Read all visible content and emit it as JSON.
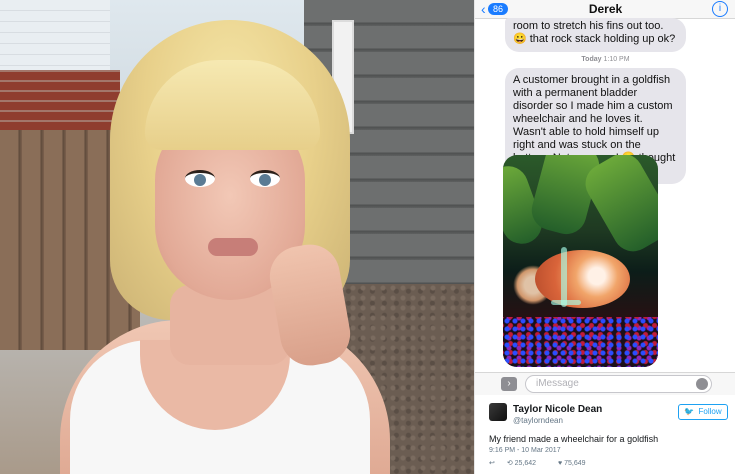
{
  "chat": {
    "back_badge": "86",
    "contact_name": "Derek",
    "msg1": "room to stretch his fins out too. 😀 that rock stack holding up ok?",
    "timestamp_day": "Today",
    "timestamp_time": "1:10 PM",
    "msg2": "A customer brought in a goldfish with a permanent bladder disorder so I made him a custom wheelchair and he loves it. Wasn't able to hold himself up right and was stuck on the bottom. Not anymore! 😀 thought u would get a kick out of it.",
    "input_placeholder": "iMessage"
  },
  "tweet": {
    "name": "Taylor Nicole Dean",
    "handle": "@taylorndean",
    "follow_label": "Follow",
    "text": "My friend made a wheelchair for a goldfish",
    "datetime": "9:16 PM - 10 Mar 2017",
    "retweets": "25,642",
    "likes": "75,649"
  },
  "icons": {
    "back": "chevron-left-icon",
    "info": "info-icon",
    "camera": "camera-icon",
    "mic": "mic-icon",
    "twitter_bird": "twitter-bird-icon",
    "reply": "reply-icon",
    "retweet": "retweet-icon",
    "like": "heart-icon"
  },
  "colors": {
    "ios_blue": "#1a7cff",
    "bubble_gray": "#e6e5eb",
    "twitter_blue": "#1da1f2"
  }
}
